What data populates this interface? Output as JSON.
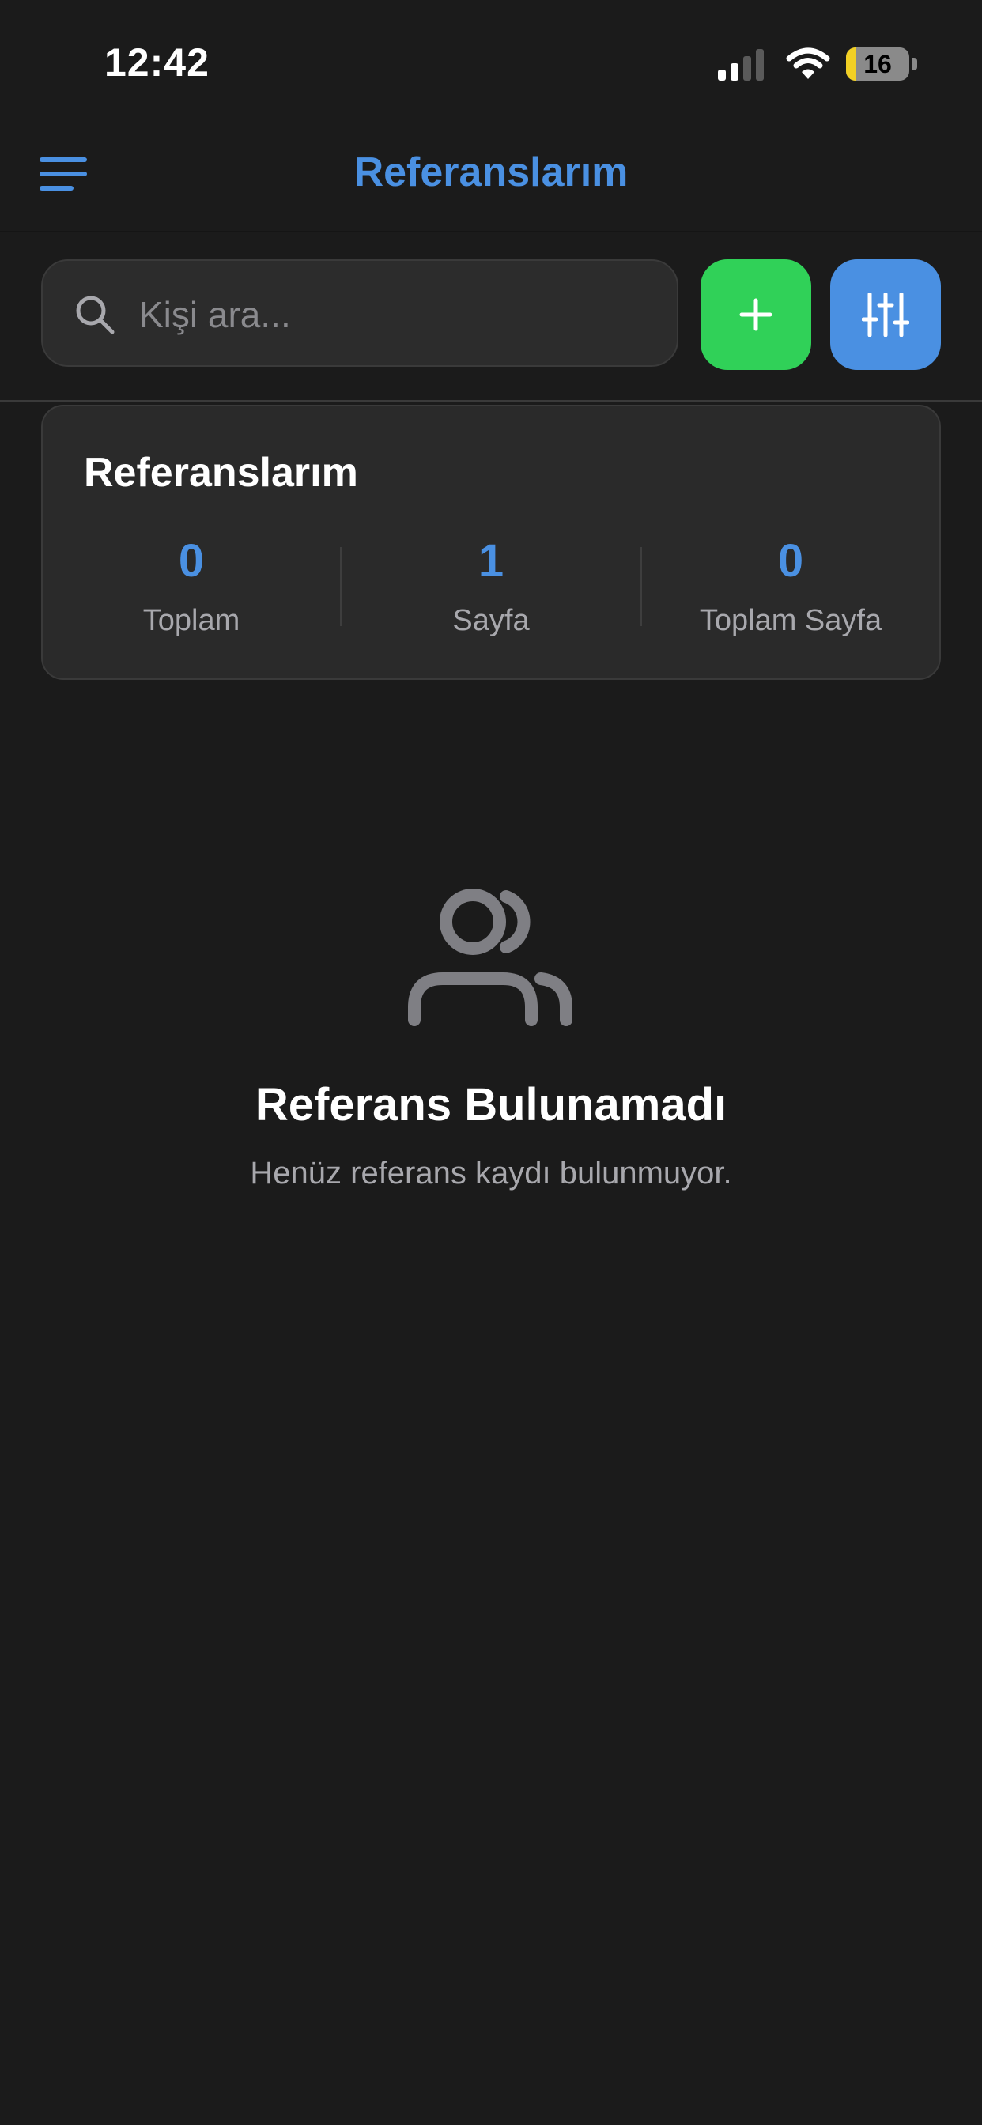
{
  "status_bar": {
    "time": "12:42",
    "battery_level": "16",
    "icons": [
      "signal-icon",
      "wifi-icon",
      "battery-icon"
    ]
  },
  "header": {
    "title": "Referanslarım",
    "menu_icon": "hamburger-menu-icon"
  },
  "search": {
    "placeholder": "Kişi ara...",
    "value": "",
    "icon": "search-icon"
  },
  "actions": {
    "add_icon": "plus-icon",
    "filter_icon": "sliders-icon"
  },
  "summary": {
    "title": "Referanslarım",
    "stats": [
      {
        "value": "0",
        "label": "Toplam"
      },
      {
        "value": "1",
        "label": "Sayfa"
      },
      {
        "value": "0",
        "label": "Toplam Sayfa"
      }
    ]
  },
  "empty_state": {
    "icon": "users-icon",
    "title": "Referans Bulunamadı",
    "subtitle": "Henüz referans kaydı bulunmuyor."
  },
  "colors": {
    "background": "#1b1b1b",
    "accent_blue": "#4a90e2",
    "accent_green": "#30d158",
    "card": "#2a2a2a",
    "muted_text": "#a8a8ad",
    "battery_low": "#f2d024"
  }
}
